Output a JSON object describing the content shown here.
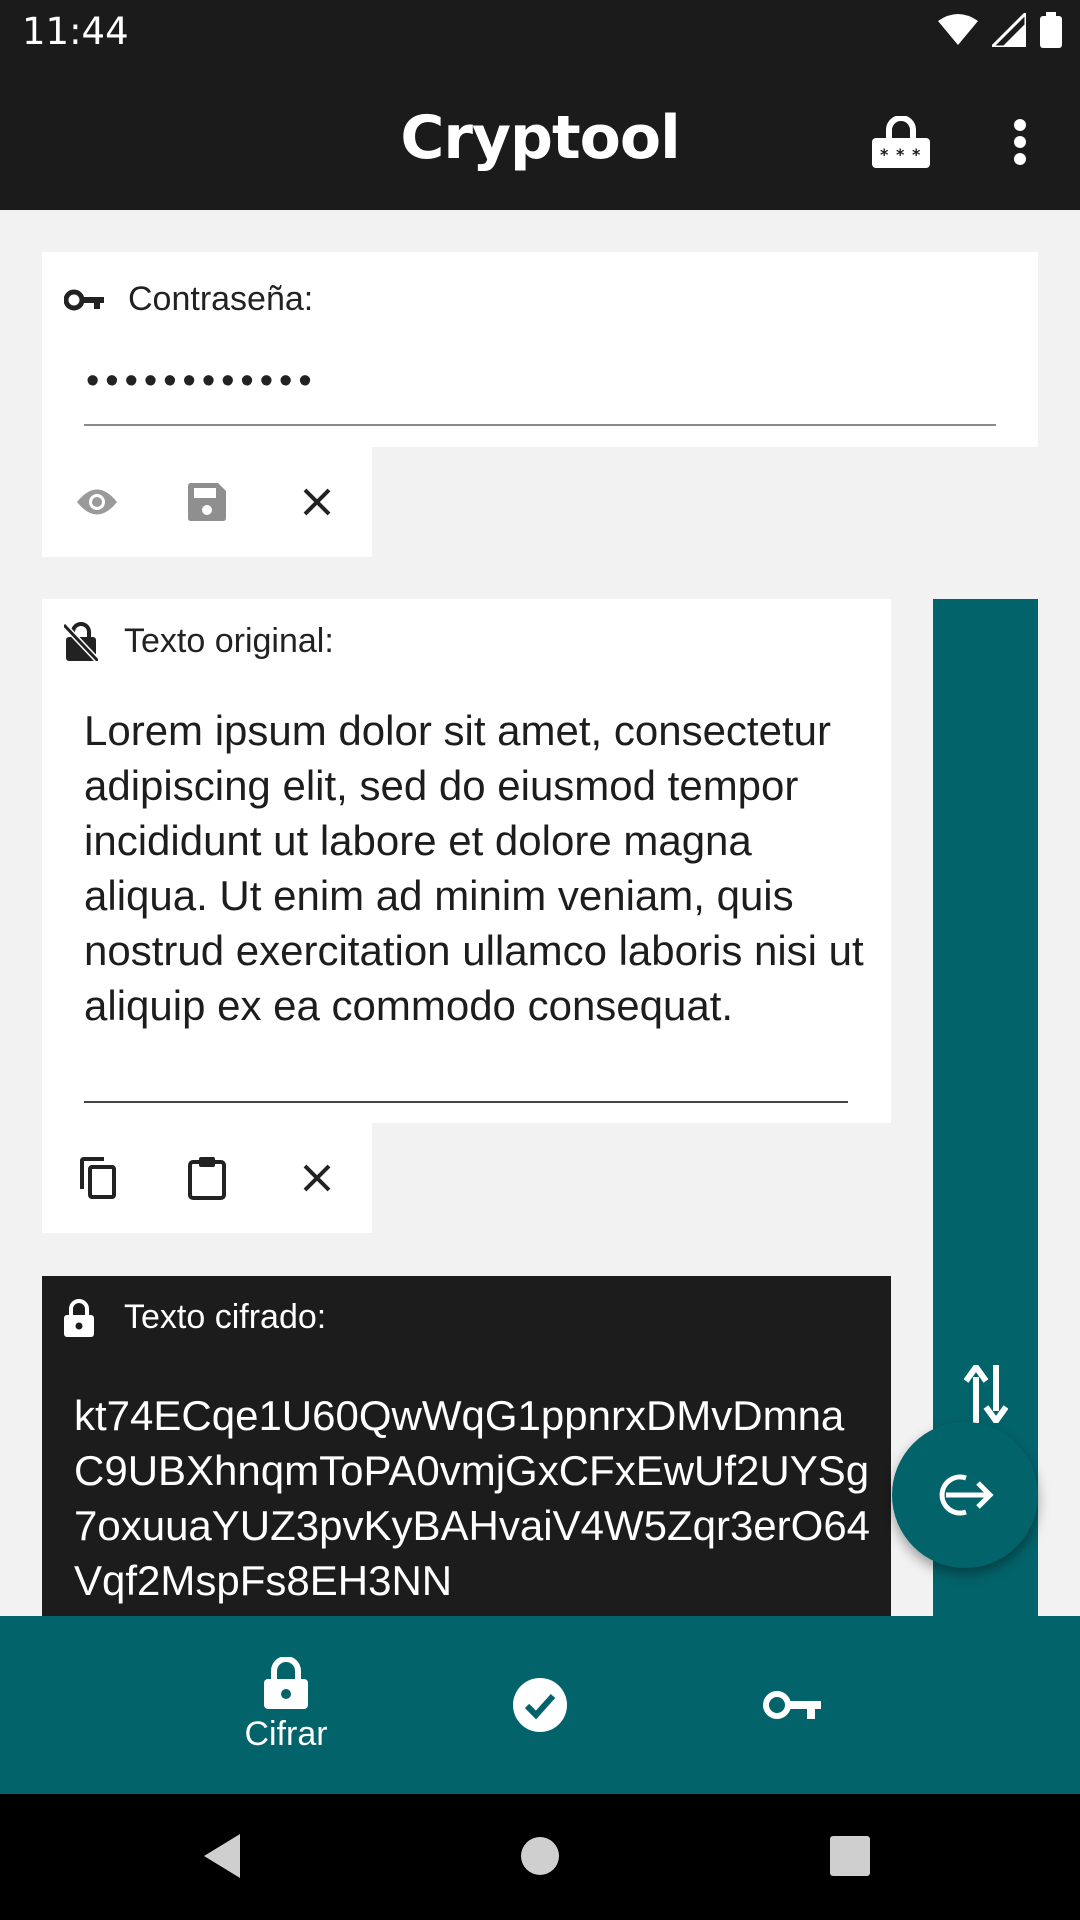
{
  "status_bar": {
    "time": "11:44"
  },
  "app_bar": {
    "title": "Cryptool"
  },
  "password": {
    "label": "Contraseña:",
    "value": "••••••••••••"
  },
  "original": {
    "label": "Texto original:",
    "text": "Lorem ipsum dolor sit amet, consectetur adipiscing elit, sed do eiusmod tempor incididunt ut labore et dolore magna aliqua. Ut enim ad minim veniam, quis nostrud exercitation ullamco laboris nisi ut aliquip ex ea commodo consequat."
  },
  "cipher": {
    "label": "Texto cifrado:",
    "text": "kt74ECqe1U60QwWqG1ppnrxDMvDmnaC9UBXhnqmToPA0vmjGxCFxEwUf2UYSg7oxuuaYUZ3pvKyBAHvaiV4W5Zqr3erO64Vqf2MspFs8EH3NN"
  },
  "bottom_nav": {
    "items": [
      {
        "label": "Cifrar",
        "icon": "lock-icon",
        "selected": true
      },
      {
        "label": "",
        "icon": "check-circle-icon",
        "selected": false
      },
      {
        "label": "",
        "icon": "key-icon",
        "selected": false
      }
    ]
  },
  "colors": {
    "accent": "#03636a",
    "bar": "#1b1b1b",
    "background": "#f2f2f2"
  },
  "icons": [
    "wifi-icon",
    "signal-icon",
    "battery-icon",
    "lock-keypad-icon",
    "more-vert-icon",
    "key-icon",
    "visibility-icon",
    "save-icon",
    "close-icon",
    "lock-off-icon",
    "copy-icon",
    "paste-icon",
    "lock-icon",
    "swap-vert-icon",
    "login-icon",
    "check-circle-icon",
    "back-icon",
    "home-icon",
    "recents-icon"
  ]
}
